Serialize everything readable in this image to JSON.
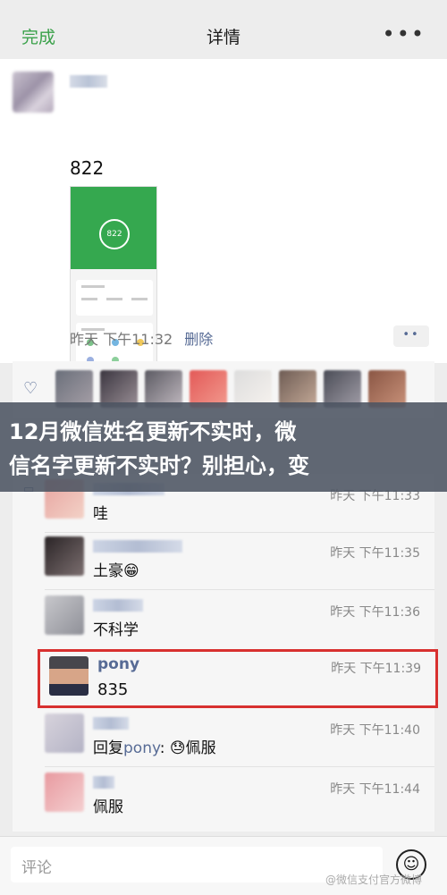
{
  "topbar": {
    "done": "完成",
    "title": "详情",
    "more": "•••"
  },
  "post": {
    "text": "822",
    "image_badge": "822",
    "time": "昨天 下午11:32",
    "delete": "删除",
    "actions": "••"
  },
  "banner": {
    "line1": "12月微信姓名更新不实时，微",
    "line2": "信名字更新不实时？别担心，变"
  },
  "comments": [
    {
      "text": "哇",
      "time": "昨天 下午11:33"
    },
    {
      "text": "土豪😁",
      "time": "昨天 下午11:35"
    },
    {
      "text": "不科学",
      "time": "昨天 下午11:36"
    },
    {
      "name": "pony",
      "text": "835",
      "time": "昨天 下午11:39"
    },
    {
      "prefix": "回复",
      "nick": "pony",
      "suffix": ": 😓佩服",
      "time": "昨天 下午11:40"
    },
    {
      "text": "佩服",
      "time": "昨天 下午11:44"
    }
  ],
  "input": {
    "placeholder": "评论"
  },
  "watermark": "@微信支付官方微博",
  "colors": {
    "accent": "#576b95",
    "done": "#3aa14a",
    "highlight": "#d8302f"
  }
}
